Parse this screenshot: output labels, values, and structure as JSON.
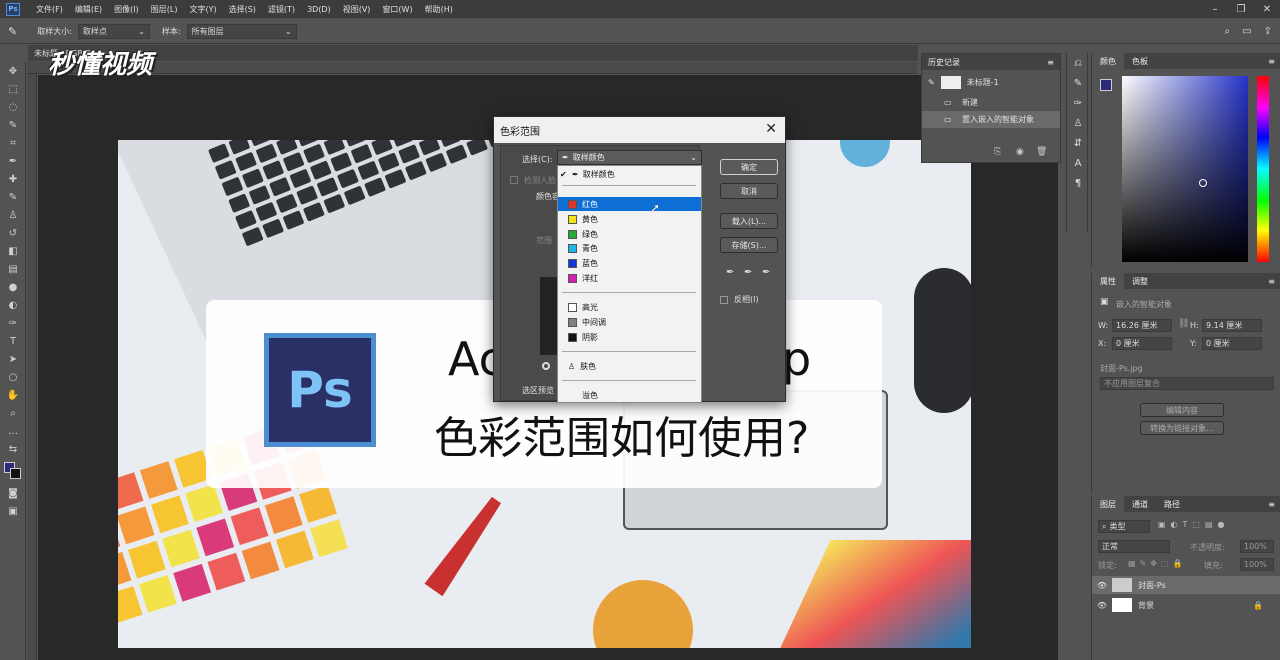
{
  "menubar": {
    "items": [
      "文件(F)",
      "编辑(E)",
      "图像(I)",
      "图层(L)",
      "文字(Y)",
      "选择(S)",
      "滤镜(T)",
      "3D(D)",
      "视图(V)",
      "窗口(W)",
      "帮助(H)"
    ],
    "win_min": "–",
    "win_max": "❐",
    "win_close": "✕"
  },
  "options": {
    "sample_size_label": "取样大小:",
    "sample_size_value": "取样点",
    "sample_label": "样本:",
    "sample_value": "所有图层"
  },
  "doc_tab": {
    "title": "未标题...RGB/8)"
  },
  "watermark": {
    "text": "秒懂视频"
  },
  "artwork": {
    "banner_line1_left": "Ac",
    "banner_line1_right": "p",
    "banner_line2": "色彩范围如何使用?",
    "ps_logo": "Ps"
  },
  "dialog": {
    "title": "色彩范围",
    "select_label": "选择(C):",
    "select_value": "取样颜色",
    "detect_faces": "检测人脸",
    "fuzziness_label": "颜色容",
    "range_label": "范围",
    "preview_label": "选区预览",
    "ok": "确定",
    "cancel": "取消",
    "load": "载入(L)...",
    "save": "存储(S)...",
    "invert": "反相(I)",
    "options": [
      {
        "label": "取样颜色",
        "check": "✔"
      },
      {
        "label": "红色",
        "color": "#e0332c"
      },
      {
        "label": "黄色",
        "color": "#f4e21b"
      },
      {
        "label": "绿色",
        "color": "#26a83a"
      },
      {
        "label": "青色",
        "color": "#1fb6e8"
      },
      {
        "label": "蓝色",
        "color": "#1437d8"
      },
      {
        "label": "洋红",
        "color": "#d21fb5"
      },
      {
        "label": "高光",
        "color": "#ffffff"
      },
      {
        "label": "中间调",
        "color": "#808080"
      },
      {
        "label": "阴影",
        "color": "#111111"
      },
      {
        "label": "肤色"
      },
      {
        "label": "溢色"
      }
    ]
  },
  "history": {
    "title": "历史记录",
    "snapshot": "未标题-1",
    "items": [
      "新建",
      "置入嵌入的智能对象"
    ]
  },
  "color_panel": {
    "tab1": "颜色",
    "tab2": "色板"
  },
  "properties": {
    "tab1": "属性",
    "tab2": "调整",
    "object_type": "嵌入的智能对象",
    "w_label": "W:",
    "w_value": "16.26 厘米",
    "h_label": "H:",
    "h_value": "9.14 厘米",
    "x_label": "X:",
    "x_value": "0 厘米",
    "y_label": "Y:",
    "y_value": "0 厘米",
    "file": "封面-Ps.jpg",
    "comp": "不应用图层复合",
    "edit_btn": "编辑内容",
    "convert_btn": "转换为链接对象..."
  },
  "layers": {
    "tabs": [
      "图层",
      "通道",
      "路径"
    ],
    "filter": "类型",
    "blend": "正常",
    "opacity_label": "不透明度:",
    "opacity": "100%",
    "lock_label": "锁定:",
    "fill_label": "填充:",
    "fill": "100%",
    "items": [
      "封面-Ps",
      "背景"
    ]
  }
}
